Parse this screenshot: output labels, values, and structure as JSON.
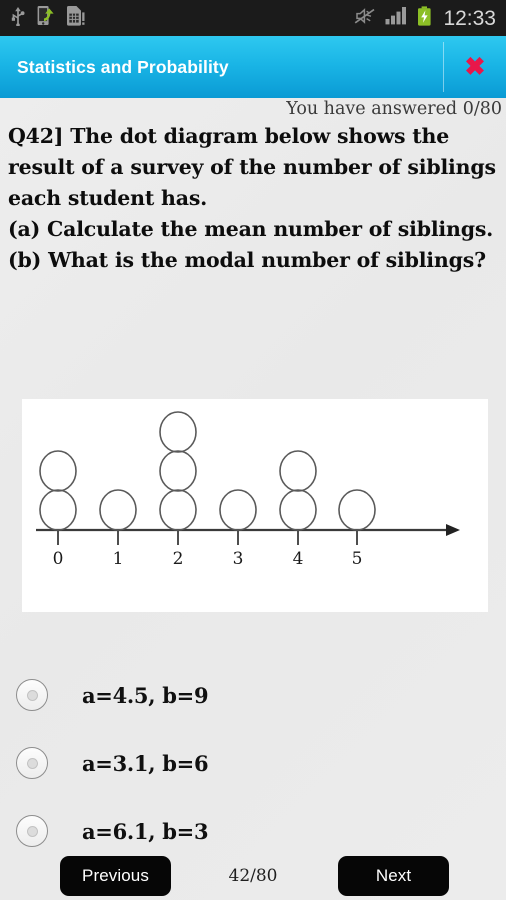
{
  "statusbar": {
    "time": "12:33",
    "icons": [
      {
        "name": "usb-icon",
        "glyph": "usb"
      },
      {
        "name": "phone-transfer-icon",
        "glyph": "phone-arrow"
      },
      {
        "name": "sim-card-alert-icon",
        "glyph": "sim"
      }
    ],
    "right_icons": [
      {
        "name": "mute-icon",
        "glyph": "speaker-muted"
      },
      {
        "name": "signal-bars-icon",
        "glyph": "signal"
      },
      {
        "name": "battery-charging-icon",
        "glyph": "battery"
      }
    ]
  },
  "header": {
    "title": "Statistics and Probability",
    "close_label": "✖",
    "accent_color": "#19b4e5",
    "close_color": "#e8174a"
  },
  "progress": {
    "answered_text": "You have answered 0/80"
  },
  "question": {
    "text": "Q42]  The dot diagram below shows the result of a survey of the number of siblings each student has.\n(a) Calculate the mean number of siblings.\n(b) What is the modal number of siblings?"
  },
  "chart_data": {
    "type": "scatter",
    "title": "",
    "xlabel": "",
    "ylabel": "",
    "categories": [
      "0",
      "1",
      "2",
      "3",
      "4",
      "5"
    ],
    "values": [
      2,
      1,
      3,
      1,
      2,
      1
    ],
    "tick_labels": [
      "0",
      "1",
      "2",
      "3",
      "4",
      "5"
    ],
    "axis_arrow": true,
    "grid": false,
    "legend": null,
    "marker": "open-circle",
    "note": "Dot plot: number of siblings per student; stacked open circles above each tick."
  },
  "options": [
    {
      "id": "opt-a",
      "label": "a=4.5, b=9",
      "selected": false
    },
    {
      "id": "opt-b",
      "label": "a=3.1, b=6",
      "selected": false
    },
    {
      "id": "opt-c",
      "label": "a=6.1, b=3",
      "selected": false
    }
  ],
  "footer": {
    "previous_label": "Previous",
    "next_label": "Next",
    "page_counter": "42/80"
  }
}
